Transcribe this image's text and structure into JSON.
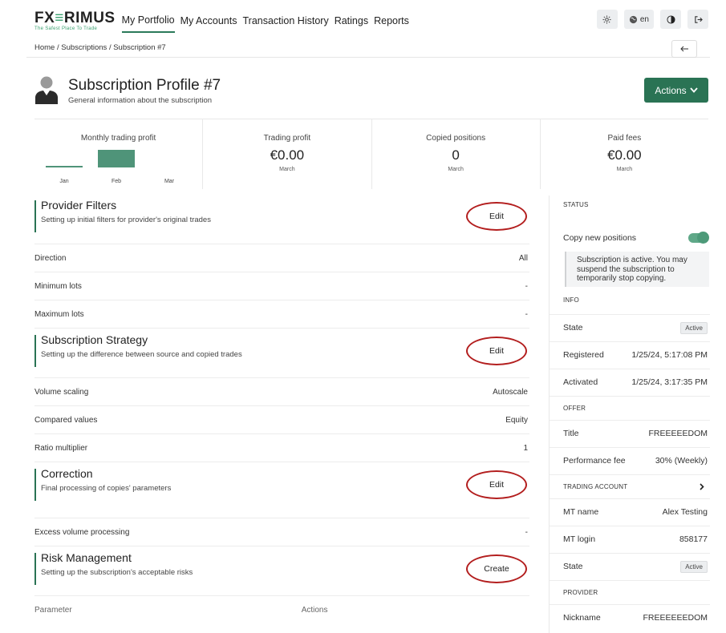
{
  "brand": {
    "logo_left": "FX",
    "logo_mid": "≡",
    "logo_right": "RIMUS",
    "tagline": "The Safest Place To Trade",
    "accent": "#2a7354",
    "highlight_ring": "#b31e1e"
  },
  "nav": {
    "items": [
      {
        "label": "My Portfolio",
        "active": true
      },
      {
        "label": "My Accounts"
      },
      {
        "label": "Transaction History"
      },
      {
        "label": "Ratings"
      },
      {
        "label": "Reports"
      }
    ],
    "lang": "en",
    "icons": [
      "gear-icon",
      "globe-icon",
      "theme-contrast-icon",
      "logout-icon"
    ]
  },
  "breadcrumb": {
    "home": "Home",
    "sep": "/",
    "subs": "Subscriptions",
    "current": "Subscription #7",
    "back_icon": "arrow-left-icon"
  },
  "header": {
    "title": "Subscription Profile #7",
    "subtitle": "General information about the subscription",
    "actions_label": "Actions"
  },
  "stats": {
    "monthly": {
      "label": "Monthly trading profit",
      "months": [
        "Jan",
        "Feb",
        "Mar"
      ]
    },
    "trading_profit": {
      "label": "Trading profit",
      "value": "€0.00",
      "sub": "March"
    },
    "copied_positions": {
      "label": "Copied positions",
      "value": "0",
      "sub": "March"
    },
    "paid_fees": {
      "label": "Paid fees",
      "value": "€0.00",
      "sub": "March"
    }
  },
  "sections": {
    "provider_filters": {
      "title": "Provider Filters",
      "desc": "Setting up initial filters for provider's original trades",
      "button": "Edit",
      "rows": [
        {
          "label": "Direction",
          "value": "All"
        },
        {
          "label": "Minimum lots",
          "value": "-"
        },
        {
          "label": "Maximum lots",
          "value": "-"
        }
      ]
    },
    "strategy": {
      "title": "Subscription Strategy",
      "desc": "Setting up the difference between source and copied trades",
      "button": "Edit",
      "rows": [
        {
          "label": "Volume scaling",
          "value": "Autoscale"
        },
        {
          "label": "Compared values",
          "value": "Equity"
        },
        {
          "label": "Ratio multiplier",
          "value": "1"
        }
      ]
    },
    "correction": {
      "title": "Correction",
      "desc": "Final processing of copies' parameters",
      "button": "Edit",
      "rows": [
        {
          "label": "Excess volume processing",
          "value": "-"
        }
      ]
    },
    "risk": {
      "title": "Risk Management",
      "desc": "Setting up the subscription's acceptable risks",
      "button": "Create",
      "col_param": "Parameter",
      "col_actions": "Actions"
    }
  },
  "sidebar": {
    "status_head": "STATUS",
    "copy_label": "Copy new positions",
    "copy_on": true,
    "note": "Subscription is active. You may suspend the subscription to temporarily stop copying.",
    "info_head": "INFO",
    "state_label": "State",
    "state_value": "Active",
    "registered_label": "Registered",
    "registered_value": "1/25/24, 5:17:08 PM",
    "activated_label": "Activated",
    "activated_value": "1/25/24, 3:17:35 PM",
    "offer_head": "OFFER",
    "title_label": "Title",
    "title_value": "FREEEEEDOM",
    "fee_label": "Performance fee",
    "fee_value": "30% (Weekly)",
    "trading_head": "TRADING ACCOUNT",
    "mt_name_label": "MT name",
    "mt_name_value": "Alex Testing",
    "mt_login_label": "MT login",
    "mt_login_value": "858177",
    "ta_state_label": "State",
    "ta_state_value": "Active",
    "provider_head": "PROVIDER",
    "nickname_label": "Nickname",
    "nickname_value": "FREEEEEEDOM"
  }
}
